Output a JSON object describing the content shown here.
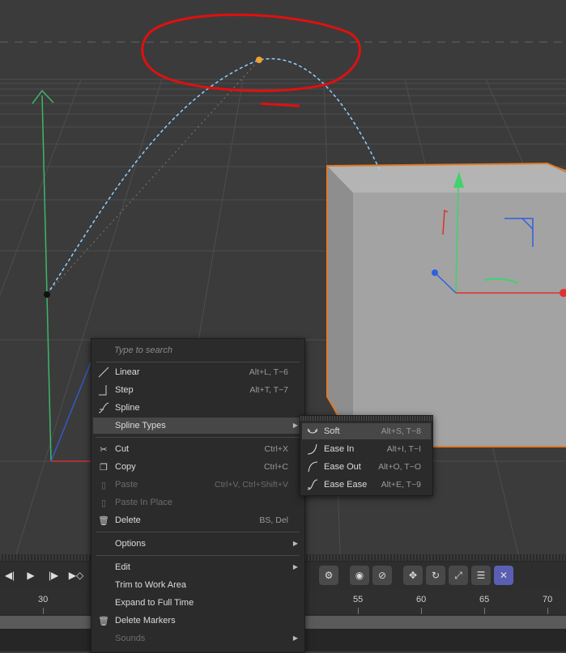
{
  "context_menu": {
    "search_placeholder": "Type to search",
    "items": [
      {
        "label": "Linear",
        "shortcut": "Alt+L, T~6"
      },
      {
        "label": "Step",
        "shortcut": "Alt+T, T~7"
      },
      {
        "label": "Spline",
        "shortcut": ""
      },
      {
        "label": "Spline Types",
        "shortcut": ""
      },
      {
        "label": "Cut",
        "shortcut": "Ctrl+X"
      },
      {
        "label": "Copy",
        "shortcut": "Ctrl+C"
      },
      {
        "label": "Paste",
        "shortcut": "Ctrl+V, Ctrl+Shift+V"
      },
      {
        "label": "Paste In Place",
        "shortcut": ""
      },
      {
        "label": "Delete",
        "shortcut": "BS, Del"
      },
      {
        "label": "Options",
        "shortcut": ""
      },
      {
        "label": "Edit",
        "shortcut": ""
      },
      {
        "label": "Trim to Work Area",
        "shortcut": ""
      },
      {
        "label": "Expand to Full Time",
        "shortcut": ""
      },
      {
        "label": "Delete Markers",
        "shortcut": ""
      },
      {
        "label": "Sounds",
        "shortcut": ""
      }
    ]
  },
  "spline_types_menu": {
    "items": [
      {
        "label": "Soft",
        "shortcut": "Alt+S, T~8"
      },
      {
        "label": "Ease In",
        "shortcut": "Alt+I, T~I"
      },
      {
        "label": "Ease Out",
        "shortcut": "Alt+O, T~O"
      },
      {
        "label": "Ease Ease",
        "shortcut": "Alt+E, T~9"
      }
    ]
  },
  "timeline": {
    "ticks": [
      "30",
      "55",
      "60",
      "65",
      "70"
    ]
  },
  "colors": {
    "selection_outline": "#e07a2a",
    "annotation": "#e01010",
    "path": "#8fd0ff",
    "accent_button": "#5a5fb4"
  }
}
